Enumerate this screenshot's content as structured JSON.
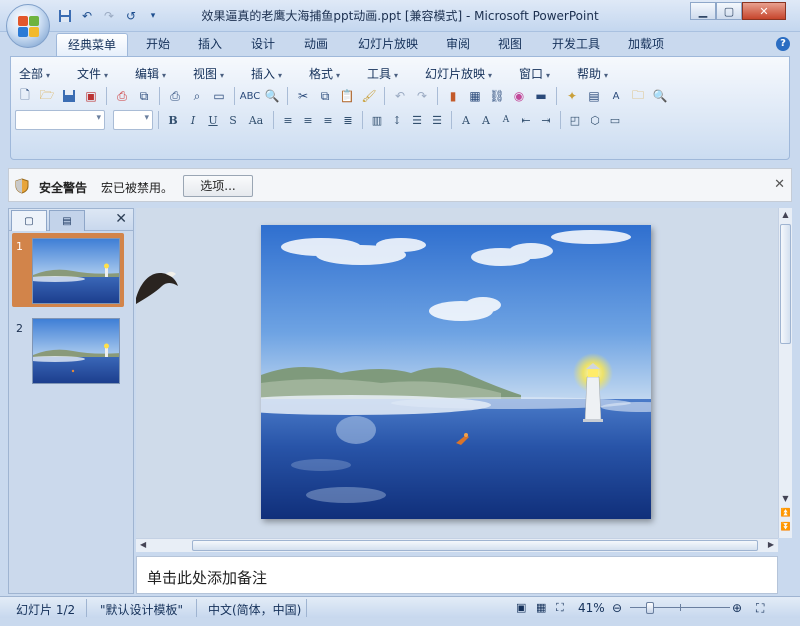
{
  "window": {
    "title": "效果逼真的老鹰大海捕鱼ppt动画.ppt [兼容模式] - Microsoft PowerPoint",
    "minimize_icon": "minimize-icon",
    "maximize_icon": "maximize-icon",
    "close_icon": "close-icon"
  },
  "quick_access": {
    "save_icon": "save-icon",
    "undo_icon": "undo-icon",
    "redo_icon": "redo-icon",
    "customize_icon": "chevron-down-icon"
  },
  "ribbon_tabs": [
    "经典菜单",
    "开始",
    "插入",
    "设计",
    "动画",
    "幻灯片放映",
    "审阅",
    "视图",
    "开发工具",
    "加载项"
  ],
  "active_tab": "经典菜单",
  "classic_menu": [
    "全部",
    "文件",
    "编辑",
    "视图",
    "插入",
    "格式",
    "工具",
    "幻灯片放映",
    "窗口",
    "帮助"
  ],
  "security_bar": {
    "title": "安全警告",
    "message": "宏已被禁用。",
    "options_button": "选项..."
  },
  "slides_panel": {
    "slide_numbers": [
      "1",
      "2"
    ],
    "selected": "1"
  },
  "notes_placeholder": "单击此处添加备注",
  "status_bar": {
    "slide_indicator": "幻灯片 1/2",
    "theme": "\"默认设计模板\"",
    "language": "中文(简体，中国)",
    "zoom": "41%"
  },
  "colors": {
    "accent": "#2b6dc2",
    "selection": "#e58a3b",
    "ribbon_bg": "#dde8f6"
  }
}
